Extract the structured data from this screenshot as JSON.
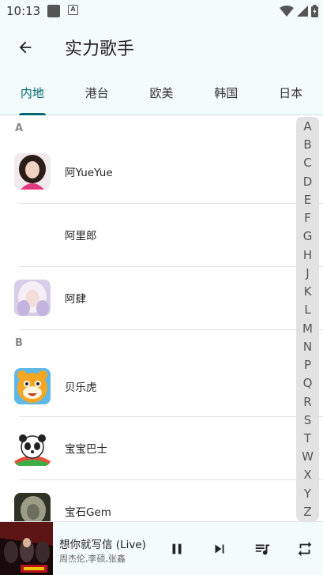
{
  "status_bar": {
    "time": "10:13"
  },
  "app_bar": {
    "title": "实力歌手"
  },
  "tabs": [
    {
      "label": "内地",
      "active": true
    },
    {
      "label": "港台",
      "active": false
    },
    {
      "label": "欧美",
      "active": false
    },
    {
      "label": "韩国",
      "active": false
    },
    {
      "label": "日本",
      "active": false
    }
  ],
  "sections": [
    {
      "letter": "A",
      "artists": [
        "阿YueYue",
        "阿里郎",
        "阿肆"
      ]
    },
    {
      "letter": "B",
      "artists": [
        "贝乐虎",
        "宝宝巴士",
        "宝石Gem"
      ]
    }
  ],
  "alphabet_index": [
    "A",
    "B",
    "C",
    "D",
    "E",
    "F",
    "G",
    "H",
    "J",
    "K",
    "L",
    "M",
    "N",
    "P",
    "Q",
    "R",
    "S",
    "T",
    "W",
    "X",
    "Y",
    "Z"
  ],
  "player": {
    "song_title": "想你就写信 (Live)",
    "song_artist": "周杰伦,李硕,张鑫"
  },
  "colors": {
    "accent": "#00696f",
    "surface": "#f3fbfb"
  }
}
